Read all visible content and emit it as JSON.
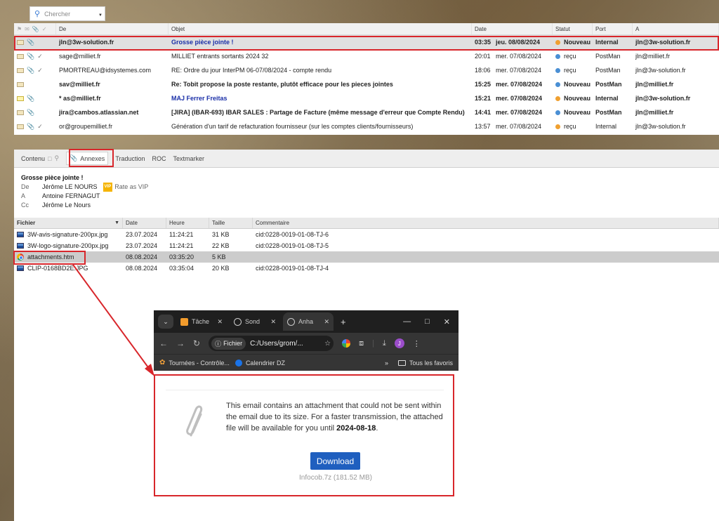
{
  "search": {
    "placeholder": "Chercher"
  },
  "mail_list": {
    "columns": {
      "from": "De",
      "subject": "Objet",
      "date": "Date",
      "status": "Statut",
      "port": "Port",
      "to": "A"
    },
    "rows": [
      {
        "from": "jln@3w-solution.fr",
        "subject": "Grosse pièce jointe !",
        "time": "03:35",
        "date": "jeu. 08/08/2024",
        "status": "Nouveau",
        "port": "Internal",
        "to": "jln@3w-solution.fr"
      },
      {
        "from": "sage@milliet.fr",
        "subject": "MILLIET entrants sortants 2024 32",
        "time": "20:01",
        "date": "mer. 07/08/2024",
        "status": "reçu",
        "port": "PostMan",
        "to": "jln@milliet.fr"
      },
      {
        "from": "PMORTREAU@idsystemes.com",
        "subject": "RE: Ordre du jour InterPM 06-07/08/2024 - compte rendu",
        "time": "18:06",
        "date": "mer. 07/08/2024",
        "status": "reçu",
        "port": "PostMan",
        "to": "jln@3w-solution.fr"
      },
      {
        "from": "sav@milliet.fr",
        "subject": "Re: Tobit propose la poste restante, plutôt efficace pour les pieces jointes",
        "time": "15:25",
        "date": "mer. 07/08/2024",
        "status": "Nouveau",
        "port": "PostMan",
        "to": "jln@milliet.fr"
      },
      {
        "from": "* as@milliet.fr",
        "subject": "MAJ Ferrer Freitas",
        "time": "15:21",
        "date": "mer. 07/08/2024",
        "status": "Nouveau",
        "port": "Internal",
        "to": "jln@3w-solution.fr"
      },
      {
        "from": "jira@cambos.atlassian.net",
        "subject": "[JIRA] (IBAR-693) IBAR SALES : Partage de Facture (même message d'erreur que Compte Rendu)",
        "time": "14:41",
        "date": "mer. 07/08/2024",
        "status": "Nouveau",
        "port": "PostMan",
        "to": "jln@milliet.fr"
      },
      {
        "from": "or@groupemilliet.fr",
        "subject": "Génération d'un tarif de refacturation fournisseur (sur les comptes clients/fournisseurs)",
        "time": "13:57",
        "date": "mer. 07/08/2024",
        "status": "reçu",
        "port": "Internal",
        "to": "jln@3w-solution.fr"
      }
    ]
  },
  "tabs": {
    "contenu": "Contenu",
    "annexes": "Annexes",
    "traduction": "Traduction",
    "roc": "ROC",
    "textmarker": "Textmarker"
  },
  "message": {
    "title": "Grosse pièce jointe !",
    "from_label": "De",
    "from": "Jérôme LE NOURS",
    "vip_badge": "VIP",
    "vip_text": "Rate as VIP",
    "to_label": "A",
    "to": "Antoine FERNAGUT",
    "cc_label": "Cc",
    "cc": "Jérôme Le Nours"
  },
  "attachments": {
    "columns": {
      "file": "Fichier",
      "date": "Date",
      "time": "Heure",
      "size": "Taille",
      "comment": "Commentaire"
    },
    "rows": [
      {
        "name": "3W-avis-signature-200px.jpg",
        "date": "23.07.2024",
        "time": "11:24:21",
        "size": "31 KB",
        "comment": "cid:0228-0019-01-08-TJ-6"
      },
      {
        "name": "3W-logo-signature-200px.jpg",
        "date": "23.07.2024",
        "time": "11:24:21",
        "size": "22 KB",
        "comment": "cid:0228-0019-01-08-TJ-5"
      },
      {
        "name": "attachments.htm",
        "date": "08.08.2024",
        "time": "03:35:20",
        "size": "5 KB",
        "comment": ""
      },
      {
        "name": "CLIP-0168BD2E.JPG",
        "date": "08.08.2024",
        "time": "03:35:04",
        "size": "20 KB",
        "comment": "cid:0228-0019-01-08-TJ-4"
      }
    ]
  },
  "browser": {
    "tabs": [
      "Tâche",
      "Sond",
      "Anha"
    ],
    "address_chip": "Fichier",
    "address": "C:/Users/grom/...",
    "bookmarks": [
      "Tournées - Contrôle...",
      "Calendrier DZ"
    ],
    "all_bookmarks": "Tous les favoris",
    "profile_initial": "J",
    "page": {
      "text_before": "This email contains an attachment that could not be sent within the email due to its size. For a faster transmission, the attached file will be available for you until ",
      "expiry": "2024-08-18",
      "text_after": ".",
      "download_label": "Download",
      "file_info": "Infocob.7z (181.52 MB)"
    }
  },
  "colors": {
    "highlight_red": "#d8262b",
    "subject_blue": "#1a2fa8",
    "download_blue": "#1f5fbf"
  }
}
